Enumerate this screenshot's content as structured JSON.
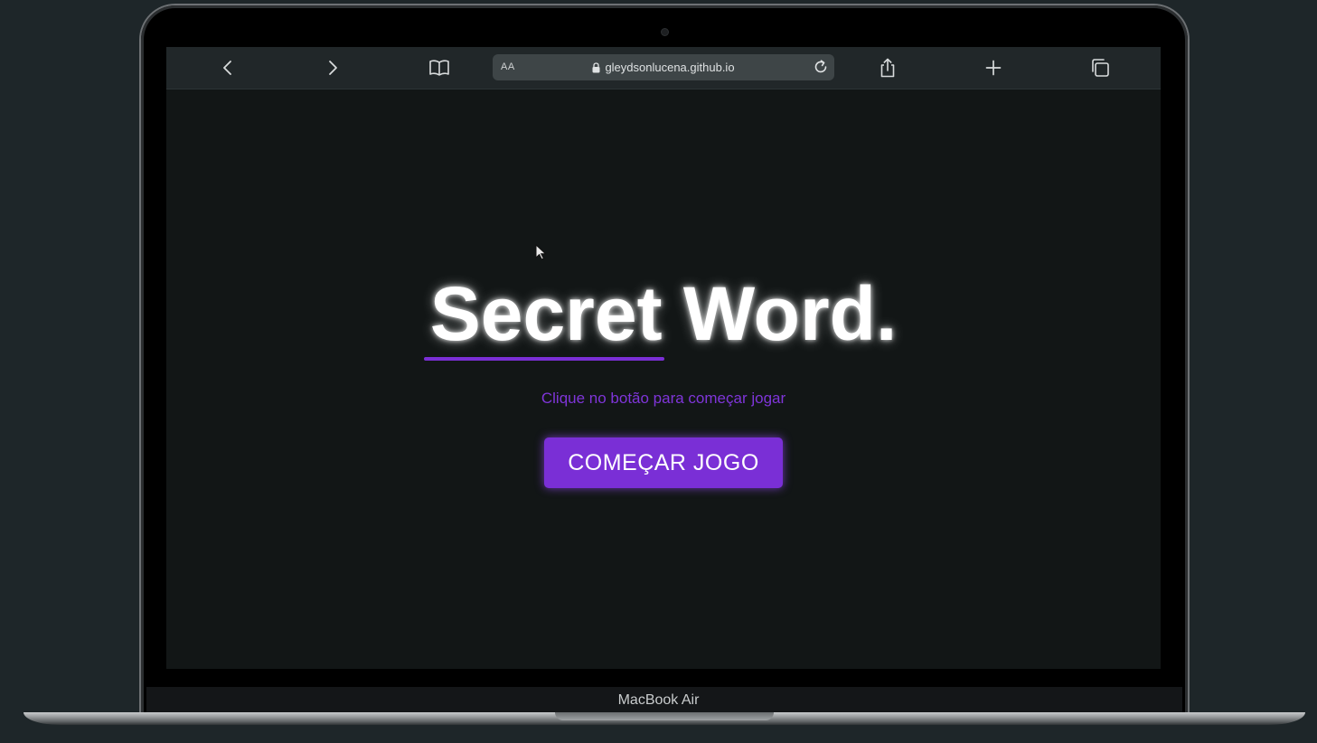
{
  "browser": {
    "url_text": "gleydsonlucena.github.io",
    "aa_label": "AA",
    "icons": {
      "back": "chevron-left-icon",
      "forward": "chevron-right-icon",
      "bookmarks": "book-icon",
      "lock": "lock-icon",
      "reload": "reload-icon",
      "share": "share-icon",
      "new_tab": "plus-icon",
      "tabs": "tabs-icon"
    }
  },
  "page": {
    "title": "Secret Word.",
    "subtitle": "Clique no botão para começar jogar",
    "start_button": "COMEÇAR JOGO"
  },
  "device": {
    "label": "MacBook Air"
  },
  "colors": {
    "accent": "#7a2fd6",
    "page_background": "#121616",
    "toolbar_background": "#212729",
    "backdrop": "#1e2629"
  }
}
